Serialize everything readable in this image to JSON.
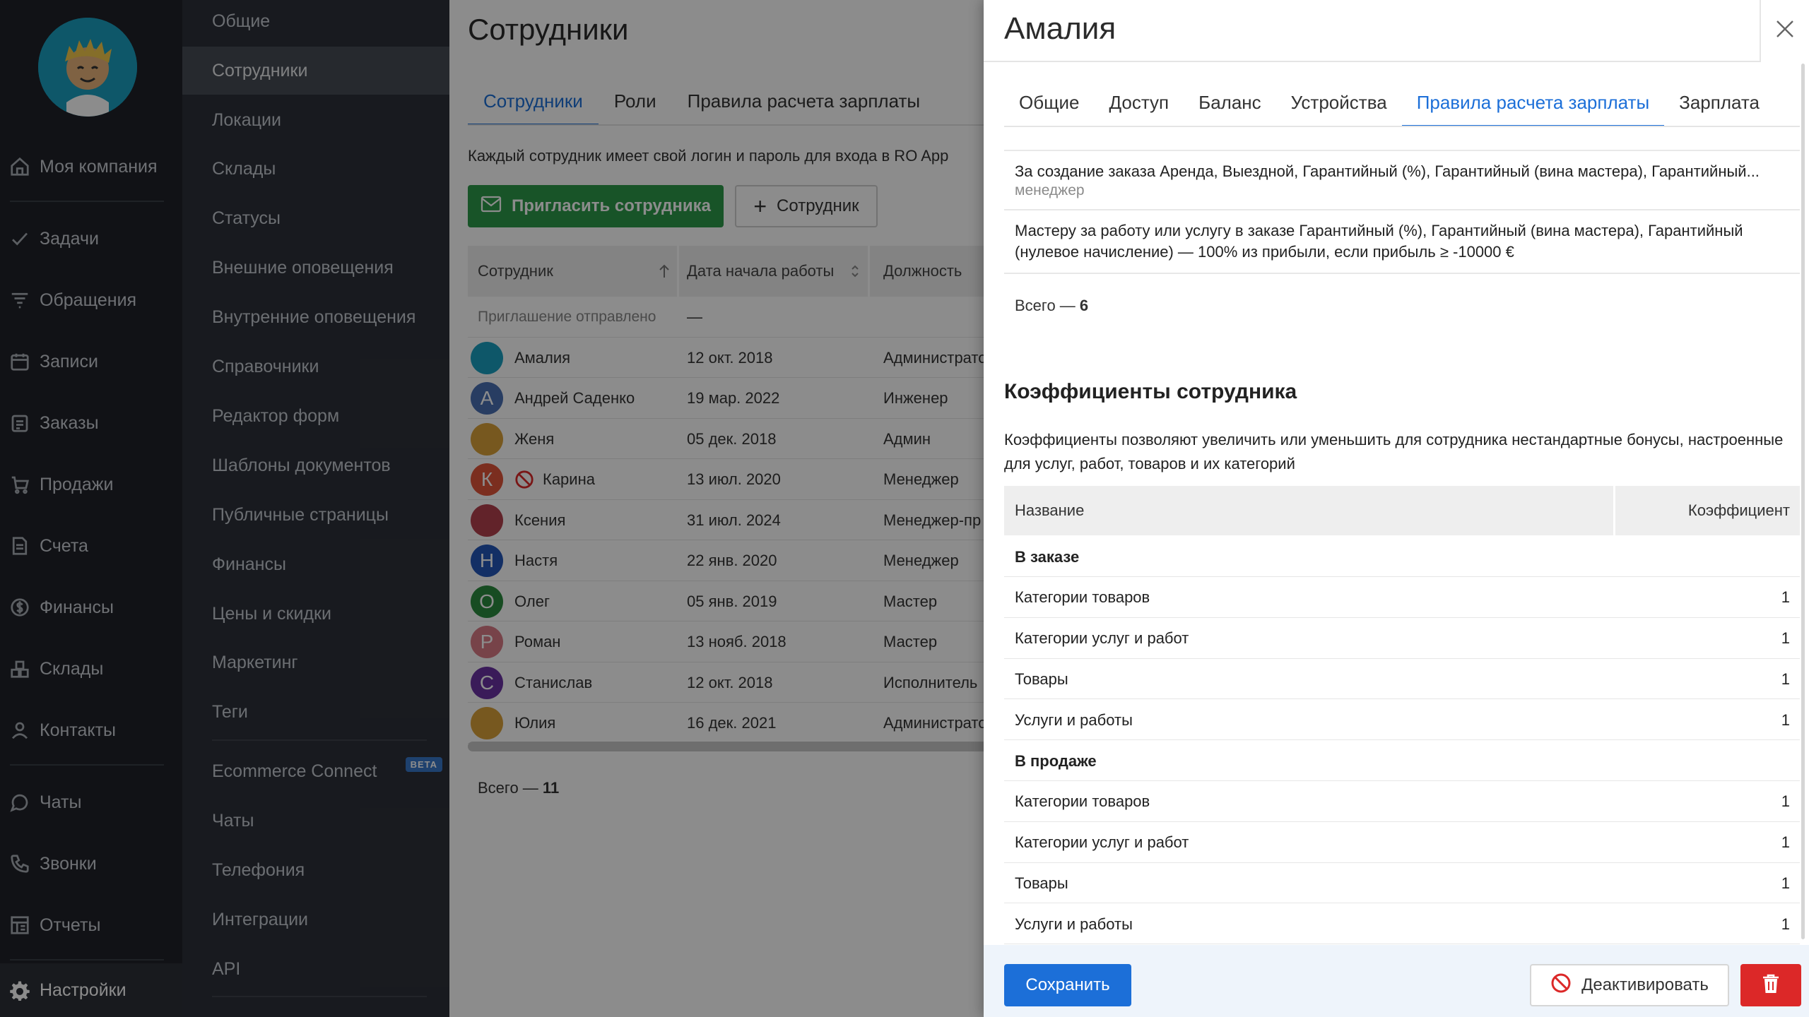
{
  "nav": {
    "items": [
      {
        "label": "Моя компания",
        "icon": "home-icon"
      },
      {
        "label": "Задачи",
        "icon": "check-icon"
      },
      {
        "label": "Обращения",
        "icon": "funnel-icon"
      },
      {
        "label": "Записи",
        "icon": "calendar-icon"
      },
      {
        "label": "Заказы",
        "icon": "clipboard-icon"
      },
      {
        "label": "Продажи",
        "icon": "cart-icon"
      },
      {
        "label": "Счета",
        "icon": "invoice-icon"
      },
      {
        "label": "Финансы",
        "icon": "dollar-icon"
      },
      {
        "label": "Склады",
        "icon": "boxes-icon"
      },
      {
        "label": "Контакты",
        "icon": "contacts-icon"
      },
      {
        "label": "Чаты",
        "icon": "chat-icon"
      },
      {
        "label": "Звонки",
        "icon": "phone-icon"
      },
      {
        "label": "Отчеты",
        "icon": "reports-icon"
      },
      {
        "label": "Настройки",
        "icon": "gear-icon"
      }
    ]
  },
  "subnav": {
    "items": [
      "Общие",
      "Сотрудники",
      "Локации",
      "Склады",
      "Статусы",
      "Внешние оповещения",
      "Внутренние оповещения",
      "Справочники",
      "Редактор форм",
      "Шаблоны документов",
      "Публичные страницы",
      "Финансы",
      "Цены и скидки",
      "Маркетинг",
      "Теги",
      "Ecommerce Connect",
      "Чаты",
      "Телефония",
      "Интеграции",
      "API"
    ],
    "beta": "BETA"
  },
  "main": {
    "title": "Сотрудники",
    "tabs": [
      "Сотрудники",
      "Роли",
      "Правила расчета зарплаты"
    ],
    "hint": "Каждый сотрудник имеет свой логин и пароль для входа в RO App",
    "invite_label": "Пригласить сотрудника",
    "add_label": "Сотрудник",
    "columns": [
      "Сотрудник",
      "Дата начала работы",
      "Должность"
    ],
    "invite_row": {
      "name": "Приглашение отправлено",
      "date": "—"
    },
    "rows": [
      {
        "letter": "",
        "name": "Амалия",
        "date": "12 окт. 2018",
        "role": "Администрато",
        "color": "#1b9fc0"
      },
      {
        "letter": "А",
        "name": "Андрей Саденко",
        "date": "19 мар. 2022",
        "role": "Инженер",
        "color": "#4a6fb3"
      },
      {
        "letter": "",
        "name": "Женя",
        "date": "05 дек. 2018",
        "role": "Админ",
        "color": "#d9a13a"
      },
      {
        "letter": "К",
        "name": "Карина",
        "date": "13 июл. 2020",
        "role": "Менеджер",
        "color": "#e0543a"
      },
      {
        "letter": "",
        "name": "Ксения",
        "date": "31 июл. 2024",
        "role": "Менеджер-пр",
        "color": "#b3414e"
      },
      {
        "letter": "Н",
        "name": "Настя",
        "date": "22 янв. 2020",
        "role": "Менеджер",
        "color": "#2456b8"
      },
      {
        "letter": "О",
        "name": "Олег",
        "date": "05 янв. 2019",
        "role": "Мастер",
        "color": "#2a8a3f"
      },
      {
        "letter": "Р",
        "name": "Роман",
        "date": "13 нояб. 2018",
        "role": "Мастер",
        "color": "#d97a86"
      },
      {
        "letter": "С",
        "name": "Станислав",
        "date": "12 окт. 2018",
        "role": "Исполнитель",
        "color": "#6a32a3"
      },
      {
        "letter": "",
        "name": "Юлия",
        "date": "16 дек. 2021",
        "role": "Администрато",
        "color": "#d9a13a"
      }
    ],
    "total_label": "Всего — ",
    "total_value": "11"
  },
  "drawer": {
    "title": "Амалия",
    "tabs": [
      "Общие",
      "Доступ",
      "Баланс",
      "Устройства",
      "Правила расчета зарплаты",
      "Зарплата"
    ],
    "rules": [
      {
        "text": "За создание заказа Аренда, Выездной, Гарантийный (%), Гарантийный (вина мастера), Гарантийный...",
        "sub": "менеджер"
      },
      {
        "text": "Мастеру за работу или услугу в заказе Гарантийный (%), Гарантийный (вина мастера), Гарантийный (нулевое начисление) — 100% из прибыли, если прибыль ≥ -10000 €",
        "sub": ""
      }
    ],
    "rules_total_label": "Всего — ",
    "rules_total_value": "6",
    "coef_title": "Коэффициенты сотрудника",
    "coef_desc": "Коэффициенты позволяют увеличить или уменьшить для сотрудника нестандартные бонусы, настроенные для услуг, работ, товаров и их категорий",
    "coef_columns": [
      "Название",
      "Коэффициент"
    ],
    "coef_rows": [
      {
        "name": "В заказе",
        "value": "",
        "group": true
      },
      {
        "name": "Категории товаров",
        "value": "1"
      },
      {
        "name": "Категории услуг и работ",
        "value": "1"
      },
      {
        "name": "Товары",
        "value": "1"
      },
      {
        "name": "Услуги и работы",
        "value": "1"
      },
      {
        "name": "В продаже",
        "value": "",
        "group": true
      },
      {
        "name": "Категории товаров",
        "value": "1"
      },
      {
        "name": "Категории услуг и работ",
        "value": "1"
      },
      {
        "name": "Товары",
        "value": "1"
      },
      {
        "name": "Услуги и работы",
        "value": "1"
      }
    ],
    "save_label": "Сохранить",
    "deactivate_label": "Деактивировать"
  },
  "colors": {
    "accent": "#1c6fd8",
    "success": "#2c9a4a",
    "danger": "#dc2828",
    "sidebar": "#1f2228",
    "subnav": "#2d3139"
  }
}
